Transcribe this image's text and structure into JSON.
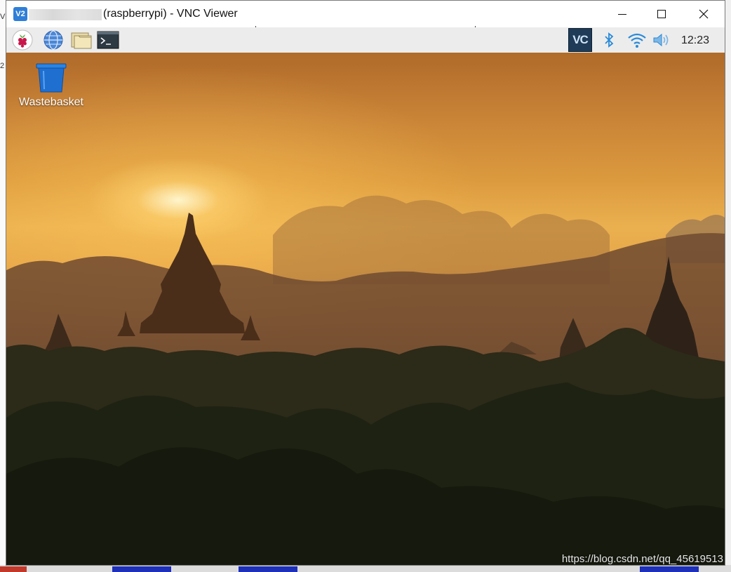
{
  "host": {
    "left_fragment": "2",
    "left_fragment_top": "V"
  },
  "window": {
    "app_icon_text": "V2",
    "title": "(raspberrypi) - VNC Viewer",
    "controls": {
      "minimize": "minimize",
      "maximize": "maximize",
      "close": "close"
    }
  },
  "panel": {
    "menu_icon": "raspberry-icon",
    "launchers": [
      {
        "name": "web-browser-icon"
      },
      {
        "name": "file-manager-icon"
      },
      {
        "name": "terminal-icon"
      }
    ],
    "tray": {
      "vnc_text": "VC",
      "clock": "12:23"
    }
  },
  "desktop": {
    "icons": [
      {
        "label": "Wastebasket",
        "icon": "wastebasket-icon"
      }
    ],
    "watermark": "https://blog.csdn.net/qq_45619513"
  },
  "colors": {
    "panel_bg": "#ececec",
    "vnc_tray_bg": "#1f3b57",
    "wifi_blue": "#2a8ad8",
    "trash_blue": "#1f6fd1"
  }
}
